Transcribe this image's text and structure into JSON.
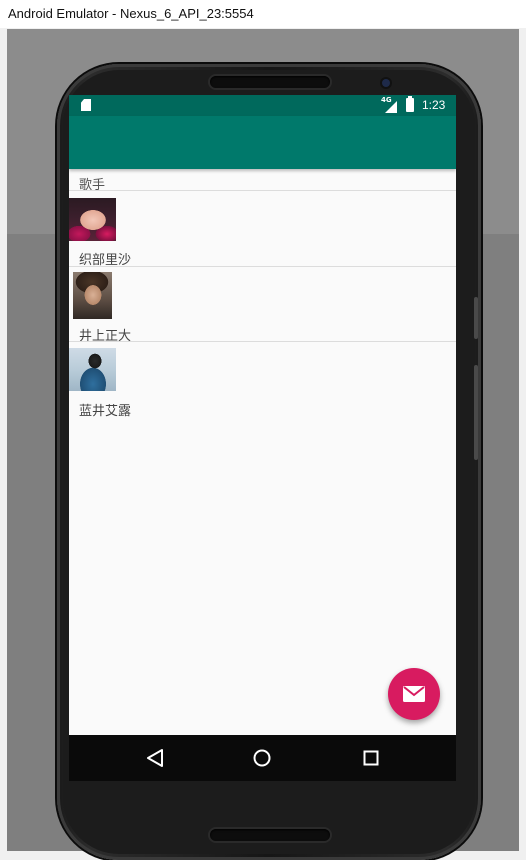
{
  "window": {
    "title": "Android Emulator - Nexus_6_API_23:5554"
  },
  "status_bar": {
    "time": "1:23",
    "network": "4G",
    "icons": [
      "sd-card-icon",
      "signal-icon",
      "battery-icon"
    ]
  },
  "app": {
    "section_header": "歌手",
    "singers": [
      {
        "name": "织部里沙",
        "avatar": "avatar-photo"
      },
      {
        "name": "井上正大",
        "avatar": "avatar-photo"
      },
      {
        "name": "蓝井艾露",
        "avatar": "avatar-photo"
      }
    ],
    "fab_icon": "mail-icon"
  },
  "nav_bar": {
    "buttons": [
      "back-icon",
      "home-icon",
      "recents-icon"
    ]
  },
  "colors": {
    "status_bar": "#00695c",
    "app_bar": "#00796b",
    "fab": "#d81b60",
    "screen_bg": "#fafafa"
  }
}
